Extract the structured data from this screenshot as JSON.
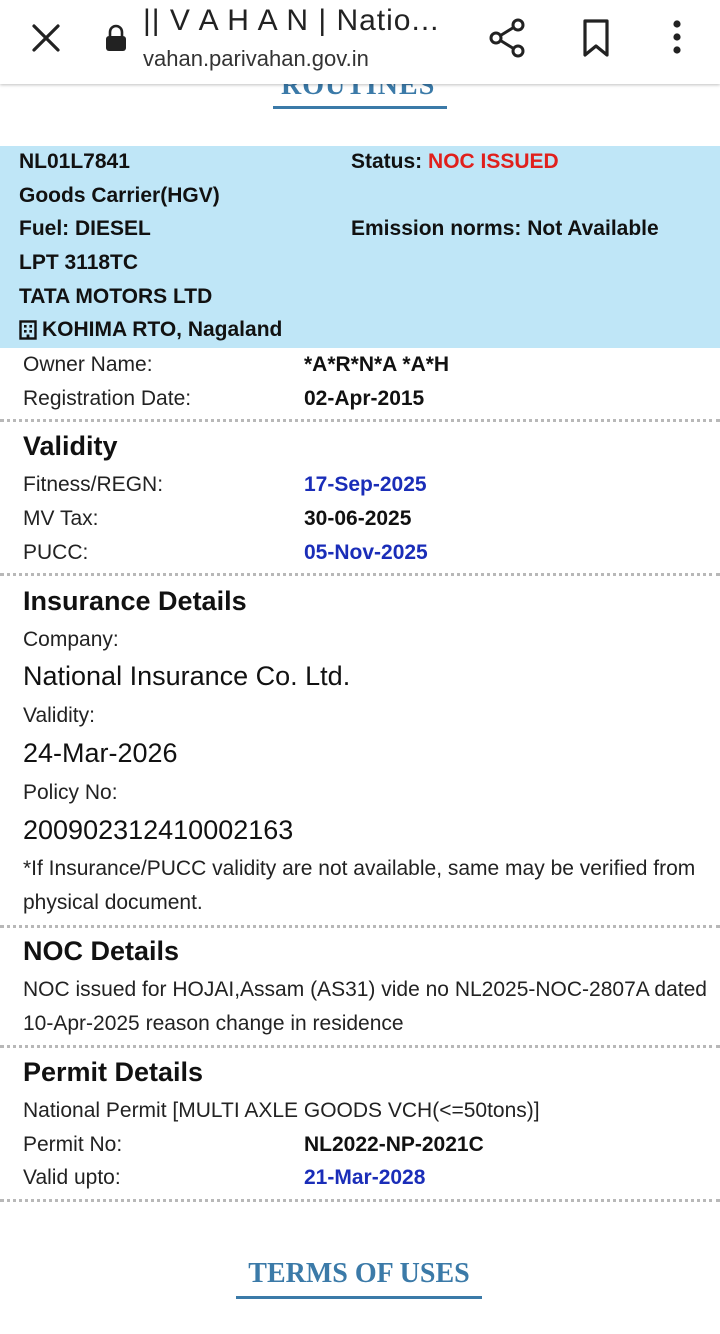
{
  "browser": {
    "title": "|| V A H A N | Natio...",
    "url": "vahan.parivahan.gov.in"
  },
  "cut_heading": "ROUTINES",
  "vehicle": {
    "reg_no": "NL01L7841",
    "status_label": "Status:",
    "status_value": "NOC ISSUED",
    "vehicle_class": "Goods Carrier(HGV)",
    "fuel": "Fuel: DIESEL",
    "emission": "Emission norms: Not Available",
    "model": "LPT 3118TC",
    "maker": "TATA MOTORS LTD",
    "rto": "KOHIMA RTO, Nagaland"
  },
  "owner": {
    "owner_label": "Owner Name:",
    "owner_value": "*A*R*N*A *A*H",
    "regdate_label": "Registration Date:",
    "regdate_value": "02-Apr-2015"
  },
  "validity": {
    "title": "Validity",
    "fitness_label": "Fitness/REGN:",
    "fitness_value": "17-Sep-2025",
    "tax_label": "MV Tax:",
    "tax_value": "30-06-2025",
    "pucc_label": "PUCC:",
    "pucc_value": "05-Nov-2025"
  },
  "insurance": {
    "title": "Insurance Details",
    "company_label": "Company:",
    "company_value": "National Insurance Co. Ltd.",
    "validity_label": "Validity:",
    "validity_value": "24-Mar-2026",
    "policy_label": "Policy No:",
    "policy_value": "200902312410002163",
    "note": "*If Insurance/PUCC validity are not available, same may be verified from physical document."
  },
  "noc": {
    "title": "NOC Details",
    "text": "NOC issued for HOJAI,Assam (AS31) vide no NL2025-NOC-2807A dated 10-Apr-2025 reason change in residence"
  },
  "permit": {
    "title": "Permit Details",
    "type": "National Permit [MULTI AXLE GOODS VCH(<=50tons)]",
    "no_label": "Permit No:",
    "no_value": "NL2022-NP-2021C",
    "valid_label": "Valid upto:",
    "valid_value": "21-Mar-2028"
  },
  "footer": {
    "terms": "TERMS OF USES"
  },
  "colors": {
    "info_bg": "#bfe6f7",
    "status_red": "#e0201c",
    "date_blue": "#1a2db8",
    "link_blue": "#3b7aa8"
  }
}
